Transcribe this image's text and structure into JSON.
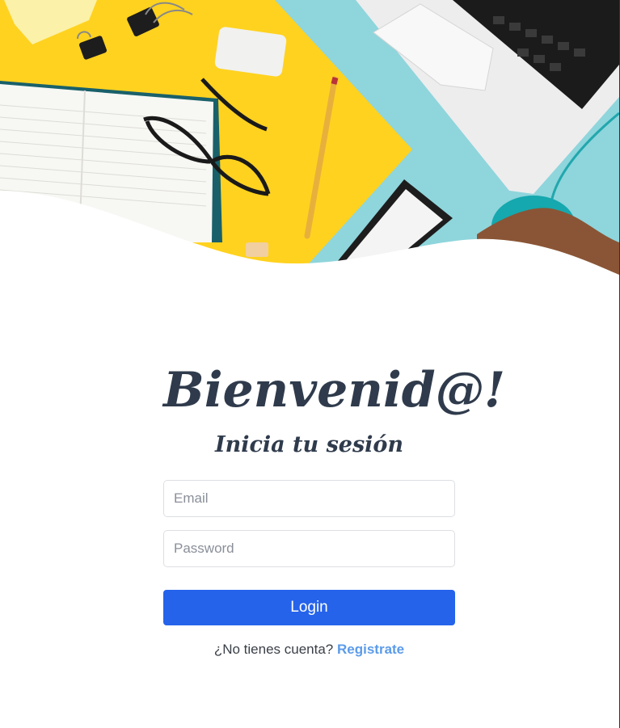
{
  "hero": {
    "image": "desk-workspace-illustration",
    "colors": {
      "yellow": "#ffd21f",
      "teal": "#8fd5dc",
      "wave": "#ffffff"
    }
  },
  "login": {
    "title": "Bienvenid@!",
    "subtitle": "Inicia tu sesión",
    "email_placeholder": "Email",
    "password_placeholder": "Password",
    "login_label": "Login",
    "signup_prompt": "¿No tienes cuenta?",
    "signup_link": "Registrate"
  },
  "colors": {
    "title": "#2f3b4c",
    "button": "#2563eb",
    "link": "#5b9bea"
  }
}
